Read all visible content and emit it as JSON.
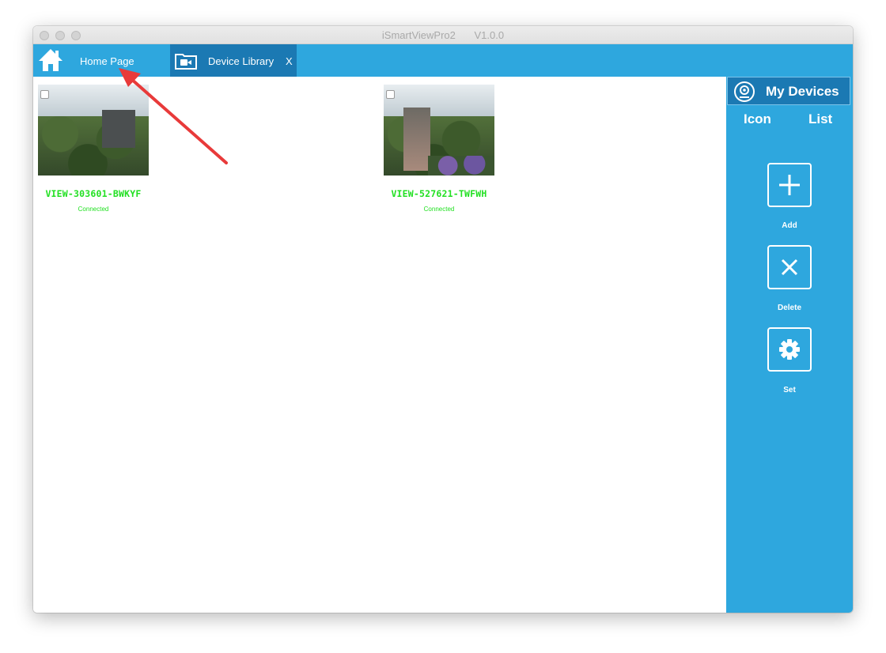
{
  "window": {
    "app_name": "iSmartViewPro2",
    "version": "V1.0.0"
  },
  "tabs": {
    "home_label": "Home Page",
    "library_label": "Device Library",
    "library_close": "X"
  },
  "devices": [
    {
      "name": "VIEW-303601-BWKYF",
      "status": "Connected"
    },
    {
      "name": "VIEW-527621-TWFWH",
      "status": "Connected"
    }
  ],
  "sidebar": {
    "title": "My Devices",
    "view_icon": "Icon",
    "view_list": "List",
    "actions": [
      {
        "label": "Add",
        "icon": "plus-icon"
      },
      {
        "label": "Delete",
        "icon": "x-icon"
      },
      {
        "label": "Set",
        "icon": "gear-icon"
      }
    ]
  },
  "colors": {
    "accent": "#2ea7de",
    "accent_dark": "#1b79b3",
    "status_green": "#22e022",
    "annotation_red": "#e83a3a"
  }
}
